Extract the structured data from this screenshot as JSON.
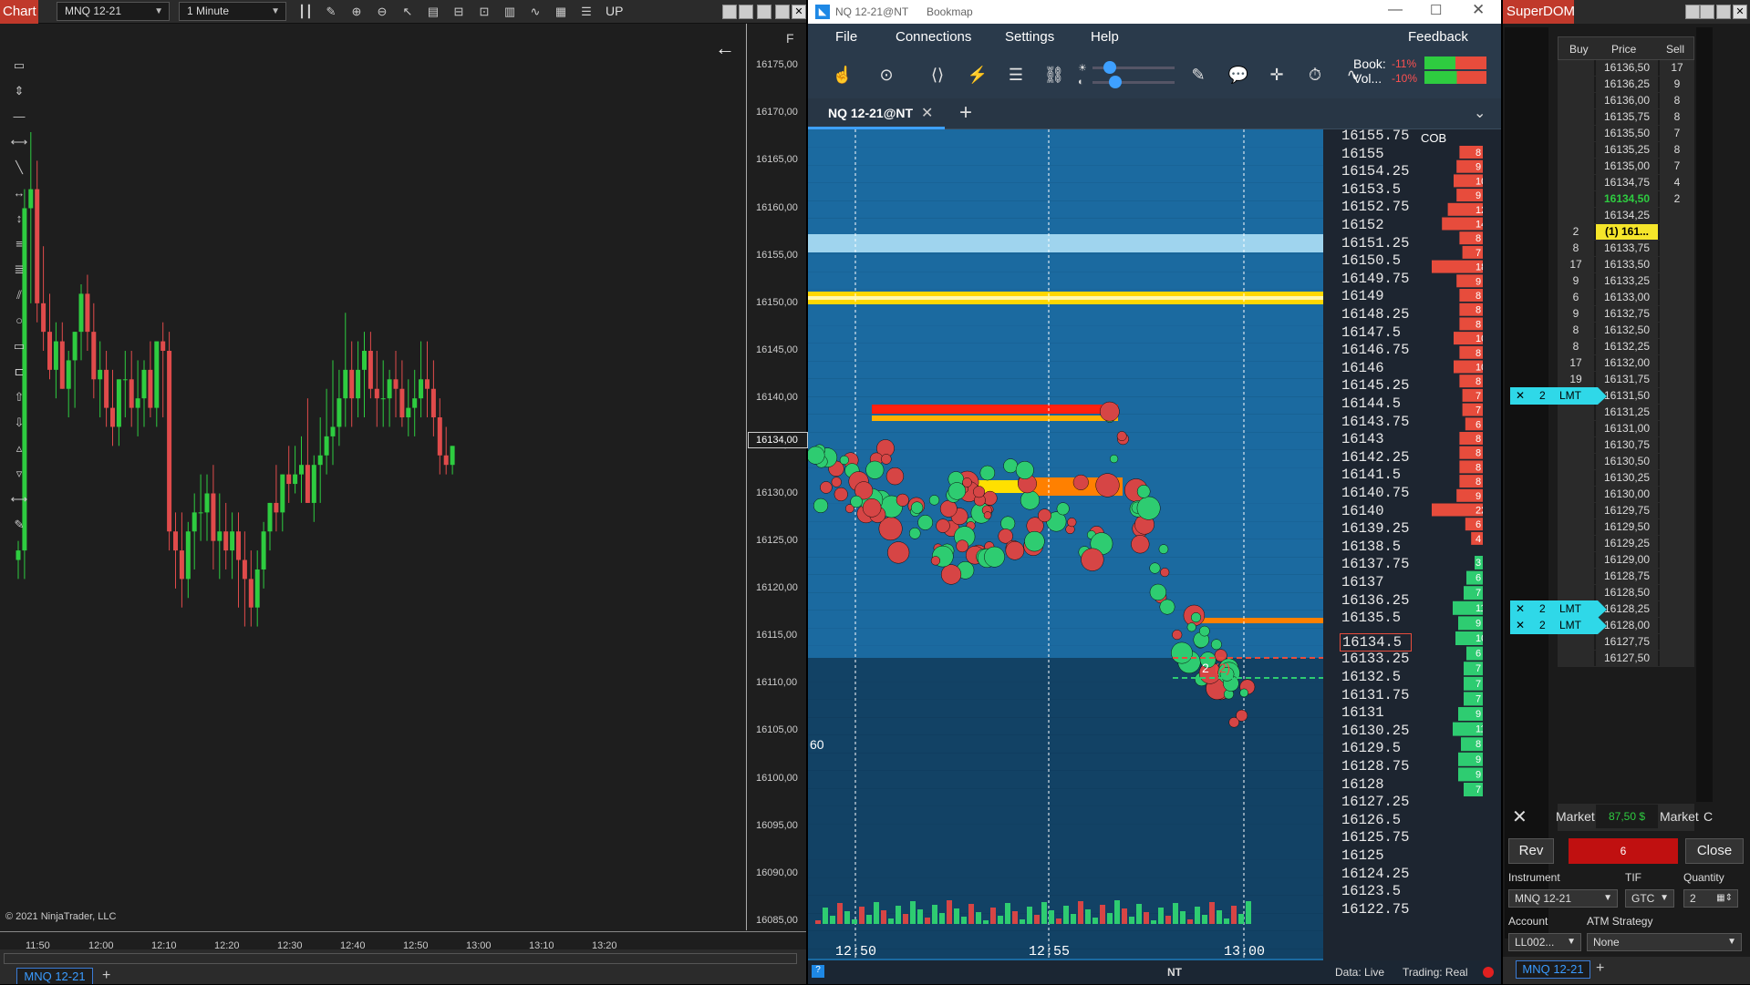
{
  "ninjatrader": {
    "title": "Chart",
    "instrument": "MNQ 12-21",
    "interval": "1 Minute",
    "up_label": "UP",
    "f_label": "F",
    "copyright": "© 2021 NinjaTrader, LLC",
    "tab": "MNQ 12-21",
    "price_marker": "16134,00",
    "y_ticks": [
      "16175,00",
      "16170,00",
      "16165,00",
      "16160,00",
      "16155,00",
      "16150,00",
      "16145,00",
      "16140,00",
      "16135,00",
      "16130,00",
      "16125,00",
      "16120,00",
      "16115,00",
      "16110,00",
      "16105,00",
      "16100,00",
      "16095,00",
      "16090,00",
      "16085,00"
    ],
    "x_ticks": [
      "11:50",
      "12:00",
      "12:10",
      "12:20",
      "12:30",
      "12:40",
      "12:50",
      "13:00",
      "13:10",
      "13:20"
    ]
  },
  "chart_data": {
    "type": "candlestick",
    "title": "MNQ 12-21",
    "xlabel": "",
    "ylabel": "",
    "ylim": [
      16081,
      16179
    ],
    "bull_color": "#2ecc40",
    "bear_color": "#e04b4b",
    "series": [
      {
        "open": [
          16123,
          16124,
          16160,
          16162,
          16150,
          16147,
          16143,
          16146,
          16141,
          16144,
          16147,
          16151,
          16147,
          16142,
          16143,
          16139,
          16137,
          16142,
          16142,
          16139,
          16140,
          16143,
          16139,
          16146,
          16145,
          16126,
          16124,
          16121,
          16126,
          16128,
          16128,
          16130,
          16125,
          16126,
          16124,
          16126,
          16123,
          16121,
          16118,
          16122,
          16126,
          16129,
          16128,
          16132,
          16131,
          16132,
          16133,
          16129,
          16133,
          16134,
          16136,
          16137,
          16140,
          16143,
          16140,
          16143,
          16145,
          16141,
          16140,
          16140,
          16142,
          16141,
          16138,
          16139,
          16140,
          16142,
          16141,
          16138,
          16134,
          16133
        ],
        "high": [
          16125,
          16162,
          16168,
          16165,
          16156,
          16151,
          16148,
          16148,
          16145,
          16147,
          16152,
          16153,
          16150,
          16146,
          16145,
          16143,
          16142,
          16145,
          16145,
          16144,
          16144,
          16146,
          16145,
          16148,
          16147,
          16128,
          16128,
          16127,
          16130,
          16132,
          16132,
          16133,
          16130,
          16129,
          16128,
          16128,
          16126,
          16124,
          16124,
          16127,
          16129,
          16133,
          16132,
          16135,
          16135,
          16136,
          16140,
          16134,
          16138,
          16141,
          16144,
          16143,
          16149,
          16146,
          16146,
          16147,
          16147,
          16145,
          16144,
          16143,
          16145,
          16144,
          16142,
          16143,
          16146,
          16146,
          16144,
          16140,
          16137,
          16135
        ],
        "low": [
          16121,
          16121,
          16150,
          16148,
          16145,
          16142,
          16140,
          16141,
          16138,
          16139,
          16144,
          16145,
          16140,
          16138,
          16137,
          16135,
          16135,
          16138,
          16137,
          16136,
          16137,
          16138,
          16137,
          16138,
          16124,
          16120,
          16118,
          16119,
          16122,
          16125,
          16125,
          16122,
          16121,
          16122,
          16121,
          16118,
          16116,
          16116,
          16116,
          16120,
          16124,
          16126,
          16126,
          16129,
          16130,
          16129,
          16129,
          16127,
          16129,
          16132,
          16133,
          16135,
          16137,
          16137,
          16138,
          16138,
          16140,
          16137,
          16137,
          16137,
          16138,
          16137,
          16136,
          16136,
          16138,
          16138,
          16136,
          16132,
          16132,
          16132
        ],
        "close": [
          16124,
          16160,
          16162,
          16150,
          16147,
          16143,
          16146,
          16141,
          16144,
          16147,
          16151,
          16147,
          16142,
          16143,
          16139,
          16137,
          16142,
          16142,
          16139,
          16140,
          16143,
          16139,
          16146,
          16145,
          16126,
          16124,
          16121,
          16126,
          16128,
          16128,
          16130,
          16125,
          16126,
          16124,
          16126,
          16123,
          16121,
          16118,
          16122,
          16126,
          16129,
          16128,
          16132,
          16131,
          16132,
          16133,
          16129,
          16133,
          16134,
          16136,
          16137,
          16140,
          16143,
          16140,
          16143,
          16145,
          16141,
          16140,
          16140,
          16142,
          16141,
          16138,
          16139,
          16140,
          16142,
          16141,
          16138,
          16134,
          16133,
          16135
        ]
      }
    ]
  },
  "bookmap": {
    "window_title": "NQ 12-21@NT",
    "app_name": "Bookmap",
    "menu": [
      "File",
      "Connections",
      "Settings",
      "Help"
    ],
    "feedback": "Feedback",
    "book_label": "Book:",
    "book_pct": "-11%",
    "vol_label": "Vol...",
    "vol_pct": "-10%",
    "tab": "NQ 12-21@NT",
    "cob_label": "COB",
    "price_levels": [
      "16155.75",
      "16155",
      "16154.25",
      "16153.5",
      "16152.75",
      "16152",
      "16151.25",
      "16150.5",
      "16149.75",
      "16149",
      "16148.25",
      "16147.5",
      "16146.75",
      "16146",
      "16145.25",
      "16144.5",
      "16143.75",
      "16143",
      "16142.25",
      "16141.5",
      "16140.75",
      "16140",
      "16139.25",
      "16138.5",
      "16137.75",
      "16137",
      "16136.25",
      "16135.5",
      "16134.5",
      "16133.25",
      "16132.5",
      "16131.75",
      "16131",
      "16130.25",
      "16129.5",
      "16128.75",
      "16128",
      "16127.25",
      "16126.5",
      "16125.75",
      "16125",
      "16124.25",
      "16123.5",
      "16122.75"
    ],
    "current_price": "16134.5",
    "order_marker": "2",
    "order_marker_paren": "(2)",
    "volume_scale": "60",
    "time_labels": [
      "12:50",
      "12:55",
      "13:00"
    ],
    "ask_sizes": [
      "8",
      "9",
      "10",
      "9",
      "12",
      "14",
      "8",
      "7",
      "18",
      "9",
      "8",
      "8",
      "8",
      "10",
      "8",
      "10",
      "8",
      "7",
      "7",
      "6",
      "8",
      "8",
      "8",
      "8",
      "9",
      "22",
      "6",
      "4"
    ],
    "bid_sizes": [
      "3",
      "6",
      "7",
      "11",
      "9",
      "10",
      "6",
      "7",
      "7",
      "7",
      "9",
      "11",
      "8",
      "9",
      "9",
      "7"
    ],
    "status_nt": "NT",
    "status_data": "Data: Live",
    "status_trading": "Trading: Real"
  },
  "superdom": {
    "title": "SuperDOM",
    "headers": [
      "Buy",
      "Price",
      "Sell"
    ],
    "rows": [
      {
        "buy": "",
        "price": "16136,50",
        "sell": "17"
      },
      {
        "buy": "",
        "price": "16136,25",
        "sell": "9"
      },
      {
        "buy": "",
        "price": "16136,00",
        "sell": "8"
      },
      {
        "buy": "",
        "price": "16135,75",
        "sell": "8"
      },
      {
        "buy": "",
        "price": "16135,50",
        "sell": "7"
      },
      {
        "buy": "",
        "price": "16135,25",
        "sell": "8"
      },
      {
        "buy": "",
        "price": "16135,00",
        "sell": "7"
      },
      {
        "buy": "",
        "price": "16134,75",
        "sell": "4"
      },
      {
        "buy": "",
        "price": "16134,50",
        "sell": "2",
        "last": true
      },
      {
        "buy": "",
        "price": "16134,25",
        "sell": ""
      },
      {
        "buy": "2",
        "price": "(1) 161...",
        "sell": "",
        "position": true
      },
      {
        "buy": "8",
        "price": "16133,75",
        "sell": ""
      },
      {
        "buy": "17",
        "price": "16133,50",
        "sell": ""
      },
      {
        "buy": "9",
        "price": "16133,25",
        "sell": ""
      },
      {
        "buy": "6",
        "price": "16133,00",
        "sell": ""
      },
      {
        "buy": "9",
        "price": "16132,75",
        "sell": ""
      },
      {
        "buy": "8",
        "price": "16132,50",
        "sell": ""
      },
      {
        "buy": "8",
        "price": "16132,25",
        "sell": ""
      },
      {
        "buy": "17",
        "price": "16132,00",
        "sell": ""
      },
      {
        "buy": "19",
        "price": "16131,75",
        "sell": ""
      },
      {
        "buy": "",
        "price": "16131,50",
        "sell": ""
      },
      {
        "buy": "",
        "price": "16131,25",
        "sell": ""
      },
      {
        "buy": "",
        "price": "16131,00",
        "sell": ""
      },
      {
        "buy": "",
        "price": "16130,75",
        "sell": ""
      },
      {
        "buy": "",
        "price": "16130,50",
        "sell": ""
      },
      {
        "buy": "",
        "price": "16130,25",
        "sell": ""
      },
      {
        "buy": "",
        "price": "16130,00",
        "sell": ""
      },
      {
        "buy": "",
        "price": "16129,75",
        "sell": ""
      },
      {
        "buy": "",
        "price": "16129,50",
        "sell": ""
      },
      {
        "buy": "",
        "price": "16129,25",
        "sell": ""
      },
      {
        "buy": "",
        "price": "16129,00",
        "sell": ""
      },
      {
        "buy": "",
        "price": "16128,75",
        "sell": ""
      },
      {
        "buy": "",
        "price": "16128,50",
        "sell": ""
      },
      {
        "buy": "",
        "price": "16128,25",
        "sell": ""
      },
      {
        "buy": "",
        "price": "16128,00",
        "sell": ""
      },
      {
        "buy": "",
        "price": "16127,75",
        "sell": ""
      },
      {
        "buy": "",
        "price": "16127,50",
        "sell": ""
      }
    ],
    "orders": [
      {
        "row_price": "16131,50",
        "qty": "2",
        "type": "LMT"
      },
      {
        "row_price": "16128,25",
        "qty": "2",
        "type": "LMT"
      },
      {
        "row_price": "16128,00",
        "qty": "2",
        "type": "LMT"
      }
    ],
    "market_left": "Market",
    "pnl": "87,50 $",
    "market_right": "Market",
    "c_label": "C",
    "rev": "Rev",
    "position_qty": "6",
    "close": "Close",
    "instrument_label": "Instrument",
    "instrument": "MNQ 12-21",
    "tif_label": "TIF",
    "tif": "GTC",
    "quantity_label": "Quantity",
    "quantity": "2",
    "account_label": "Account",
    "account": "LL002...",
    "atm_label": "ATM Strategy",
    "atm": "None",
    "tab": "MNQ 12-21"
  }
}
